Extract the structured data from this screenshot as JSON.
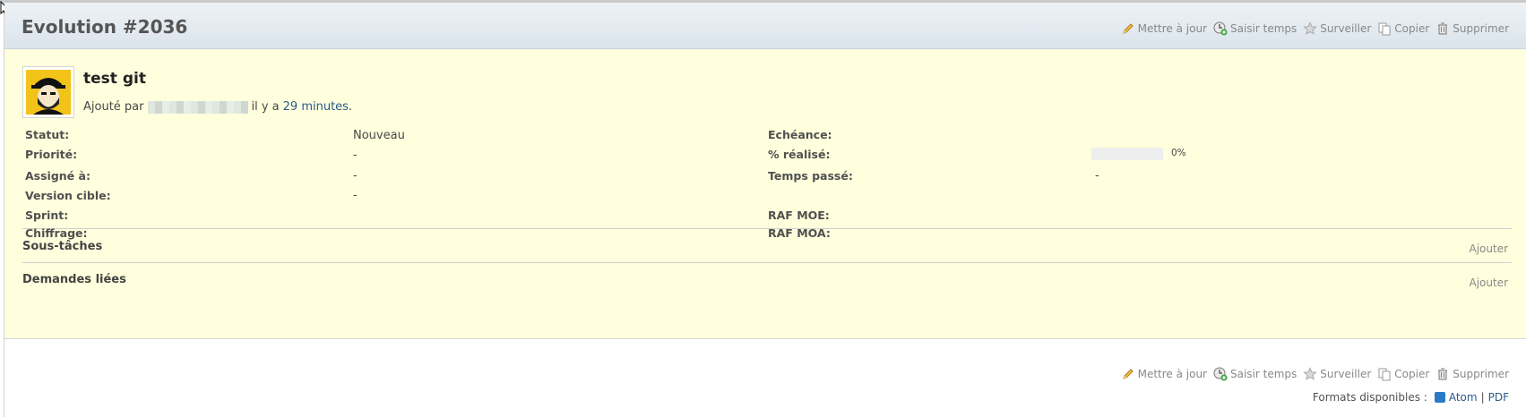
{
  "issue": {
    "title": "Evolution #2036",
    "subject": "test git",
    "author_prefix": "Ajouté par",
    "author_suffix": "il y a",
    "age_link": "29 minutes",
    "age_end": "."
  },
  "actions": [
    {
      "label": "Mettre à jour",
      "icon": "pencil-icon"
    },
    {
      "label": "Saisir temps",
      "icon": "clock-add-icon"
    },
    {
      "label": "Surveiller",
      "icon": "star-icon"
    },
    {
      "label": "Copier",
      "icon": "copy-icon"
    },
    {
      "label": "Supprimer",
      "icon": "trash-icon"
    }
  ],
  "attributes": {
    "left": [
      {
        "label": "Statut:",
        "value": "Nouveau"
      },
      {
        "label": "Priorité:",
        "value": "-"
      },
      {
        "label": "Assigné à:",
        "value": "-"
      },
      {
        "label": "Version cible:",
        "value": "-"
      },
      {
        "label": "Sprint:",
        "value": ""
      },
      {
        "label": "Chiffrage:",
        "value": ""
      }
    ],
    "right": [
      {
        "label": "Echéance:",
        "value": ""
      },
      {
        "label": "% réalisé:",
        "value": "0%"
      },
      {
        "label": "Temps passé:",
        "value": "-"
      },
      {
        "label": "RAF MOE:",
        "value": ""
      },
      {
        "label": "RAF MOA:",
        "value": ""
      }
    ]
  },
  "progress": {
    "percent": 0
  },
  "sections": [
    {
      "title": "Sous-tâches",
      "action": "Ajouter"
    },
    {
      "title": "Demandes liées",
      "action": "Ajouter"
    }
  ],
  "formats": {
    "label": "Formats disponibles :",
    "atom": "Atom",
    "separator": "|",
    "pdf": "PDF"
  },
  "colors": {
    "issue_background": "#ffffdd",
    "link": "#2a5a8a",
    "header_gradient_top": "#eef2f5",
    "header_gradient_bottom": "#dbe4ec"
  }
}
